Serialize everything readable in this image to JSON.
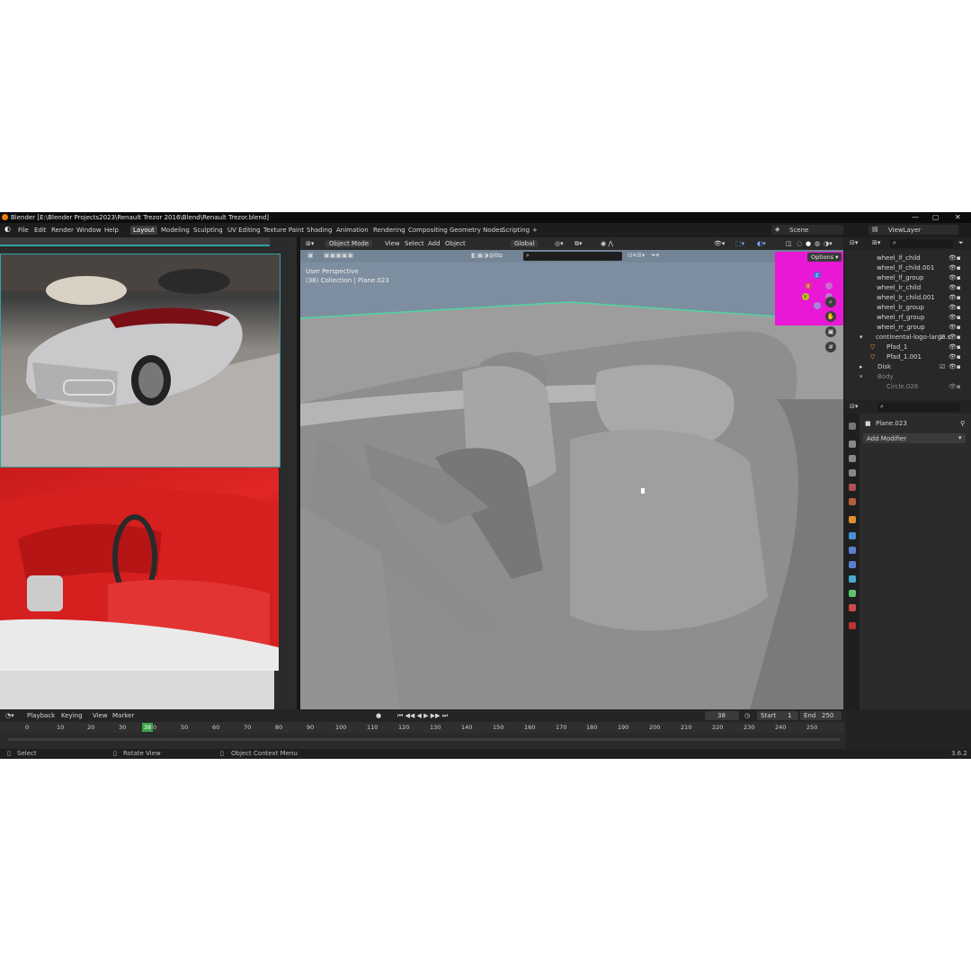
{
  "window": {
    "title": "Blender [E:\\Blender Projects2023\\Renault Trezor 2016\\Blend\\Renault Trezor.blend]",
    "minimize": "—",
    "maximize": "▢",
    "close": "✕"
  },
  "menu": [
    "File",
    "Edit",
    "Render",
    "Window",
    "Help"
  ],
  "workspaces": [
    "Layout",
    "Modeling",
    "Sculpting",
    "UV Editing",
    "Texture Paint",
    "Shading",
    "Animation",
    "Rendering",
    "Compositing",
    "Geometry Nodes",
    "Scripting"
  ],
  "add_workspace": "+",
  "scene": {
    "label": "Scene",
    "view_layer": "ViewLayer"
  },
  "viewport": {
    "mode": "Object Mode",
    "menu": [
      "View",
      "Select",
      "Add",
      "Object"
    ],
    "transform": "Global",
    "info_line1": "User Perspective",
    "info_line2": "(38) Collection | Plane.023",
    "options": "Options",
    "gizmo_axes": [
      "X",
      "Y",
      "Z"
    ]
  },
  "outliner": {
    "items": [
      {
        "label": "wheel_lf_child",
        "indent": 1
      },
      {
        "label": "wheel_lf_child.001",
        "indent": 1
      },
      {
        "label": "wheel_lf_group",
        "indent": 1
      },
      {
        "label": "wheel_lr_child",
        "indent": 1
      },
      {
        "label": "wheel_lr_child.001",
        "indent": 1
      },
      {
        "label": "wheel_lr_group",
        "indent": 1
      },
      {
        "label": "wheel_rf_group",
        "indent": 1
      },
      {
        "label": "wheel_rr_group",
        "indent": 1
      },
      {
        "label": "continental-logo-large.s",
        "indent": 0
      },
      {
        "label": "Pfad_1",
        "indent": 1
      },
      {
        "label": "Pfad_1.001",
        "indent": 1
      },
      {
        "label": "Disk",
        "indent": 0
      },
      {
        "label": "Body",
        "indent": 0
      },
      {
        "label": "Circle.026",
        "indent": 1
      }
    ]
  },
  "properties": {
    "object": "Plane.023",
    "add_modifier": "Add Modifier"
  },
  "timeline": {
    "menu": [
      "Playback",
      "Keying",
      "View",
      "Marker"
    ],
    "current_frame": "38",
    "start_label": "Start",
    "start": "1",
    "end_label": "End",
    "end": "250",
    "ruler": [
      "0",
      "10",
      "20",
      "30",
      "40",
      "50",
      "60",
      "70",
      "80",
      "90",
      "100",
      "110",
      "120",
      "130",
      "140",
      "150",
      "160",
      "170",
      "180",
      "190",
      "200",
      "210",
      "220",
      "230",
      "240",
      "250"
    ]
  },
  "statusbar": {
    "select": "Select",
    "rotate": "Rotate View",
    "context": "Object Context Menu",
    "version": "3.6.2"
  },
  "colors": {
    "accent_magenta": "#e917d6",
    "selection_outline": "#4fd6a0",
    "timeline_frame": "#3aa34a",
    "active_tab": "#3d3d3d"
  }
}
